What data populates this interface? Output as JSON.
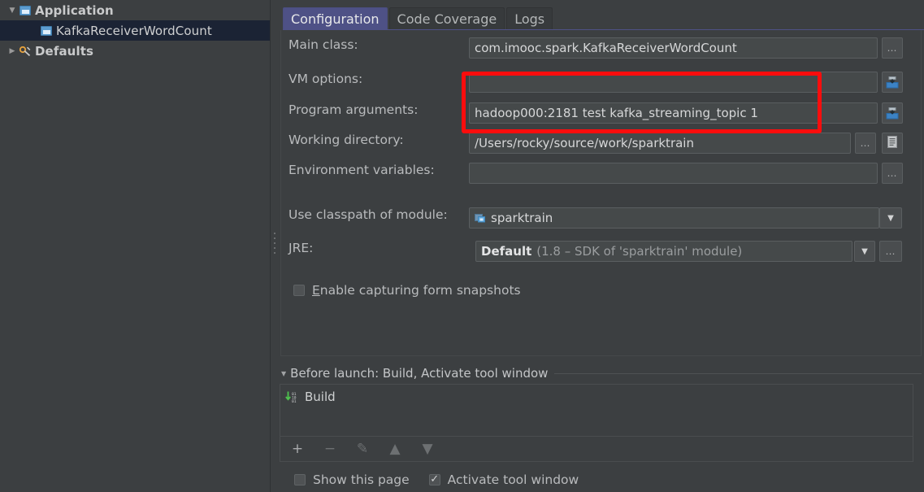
{
  "sidebar": {
    "items": [
      {
        "label": "Application",
        "icon": "application-icon",
        "twisty": "▼",
        "level": 0,
        "selected": false
      },
      {
        "label": "KafkaReceiverWordCount",
        "icon": "application-icon",
        "twisty": "",
        "level": 1,
        "selected": true
      },
      {
        "label": "Defaults",
        "icon": "wrench-icon",
        "twisty": "▶",
        "level": 0,
        "selected": false
      }
    ]
  },
  "tabs": [
    {
      "label": "Configuration",
      "active": true
    },
    {
      "label": "Code Coverage",
      "active": false
    },
    {
      "label": "Logs",
      "active": false
    }
  ],
  "form": {
    "main_class": {
      "label": "Main class:",
      "value": "com.imooc.spark.KafkaReceiverWordCount",
      "button": "…"
    },
    "vm_options": {
      "label": "VM options:",
      "value": "",
      "placeholder": "",
      "button": "insert-macro-icon"
    },
    "program_arguments": {
      "label": "Program arguments:",
      "value": "hadoop000:2181 test kafka_streaming_topic 1",
      "button": "insert-macro-icon"
    },
    "working_directory": {
      "label": "Working directory:",
      "value": "/Users/rocky/source/work/sparktrain",
      "button": "…",
      "button2": "document-icon"
    },
    "environment_variables": {
      "label": "Environment variables:",
      "value": "",
      "button": "…"
    },
    "use_classpath_of_module": {
      "label": "Use classpath of module:",
      "value": "sparktrain",
      "icon": "module-icon",
      "arrow": "▼"
    },
    "jre": {
      "label": "JRE:",
      "value": "Default",
      "value_hint": "(1.8 – SDK of 'sparktrain' module)",
      "arrow": "▼",
      "button": "…"
    },
    "enable_capturing": {
      "label": "Enable capturing form snapshots",
      "checked": false
    }
  },
  "before_launch": {
    "header": "Before launch: Build, Activate tool window",
    "twisty": "▼",
    "items": [
      {
        "label": "Build",
        "icon": "build-icon"
      }
    ],
    "toolbar": [
      {
        "name": "add-button",
        "glyph": "+",
        "enabled": true
      },
      {
        "name": "remove-button",
        "glyph": "−",
        "enabled": false
      },
      {
        "name": "edit-button",
        "glyph": "✎",
        "enabled": false
      },
      {
        "name": "move-up-button",
        "glyph": "▲",
        "enabled": false
      },
      {
        "name": "move-down-button",
        "glyph": "▼",
        "enabled": false
      }
    ],
    "checkboxes": [
      {
        "label": "Show this page",
        "checked": false
      },
      {
        "label": "Activate tool window",
        "checked": true
      }
    ]
  },
  "annotation": {
    "type": "red-rectangle-highlight",
    "color": "#fb0d0d",
    "covers": [
      "VM options field",
      "Program arguments field"
    ]
  },
  "colors": {
    "window_bg": "#3c3f41",
    "field_bg": "#45494a",
    "tab_active_bg": "#4e5186",
    "tree_selected_bg": "#1b2334",
    "annotation_red": "#fb0d0d",
    "build_icon_green": "#4ec44e",
    "module_icon_blue": "#5c9ccf"
  }
}
